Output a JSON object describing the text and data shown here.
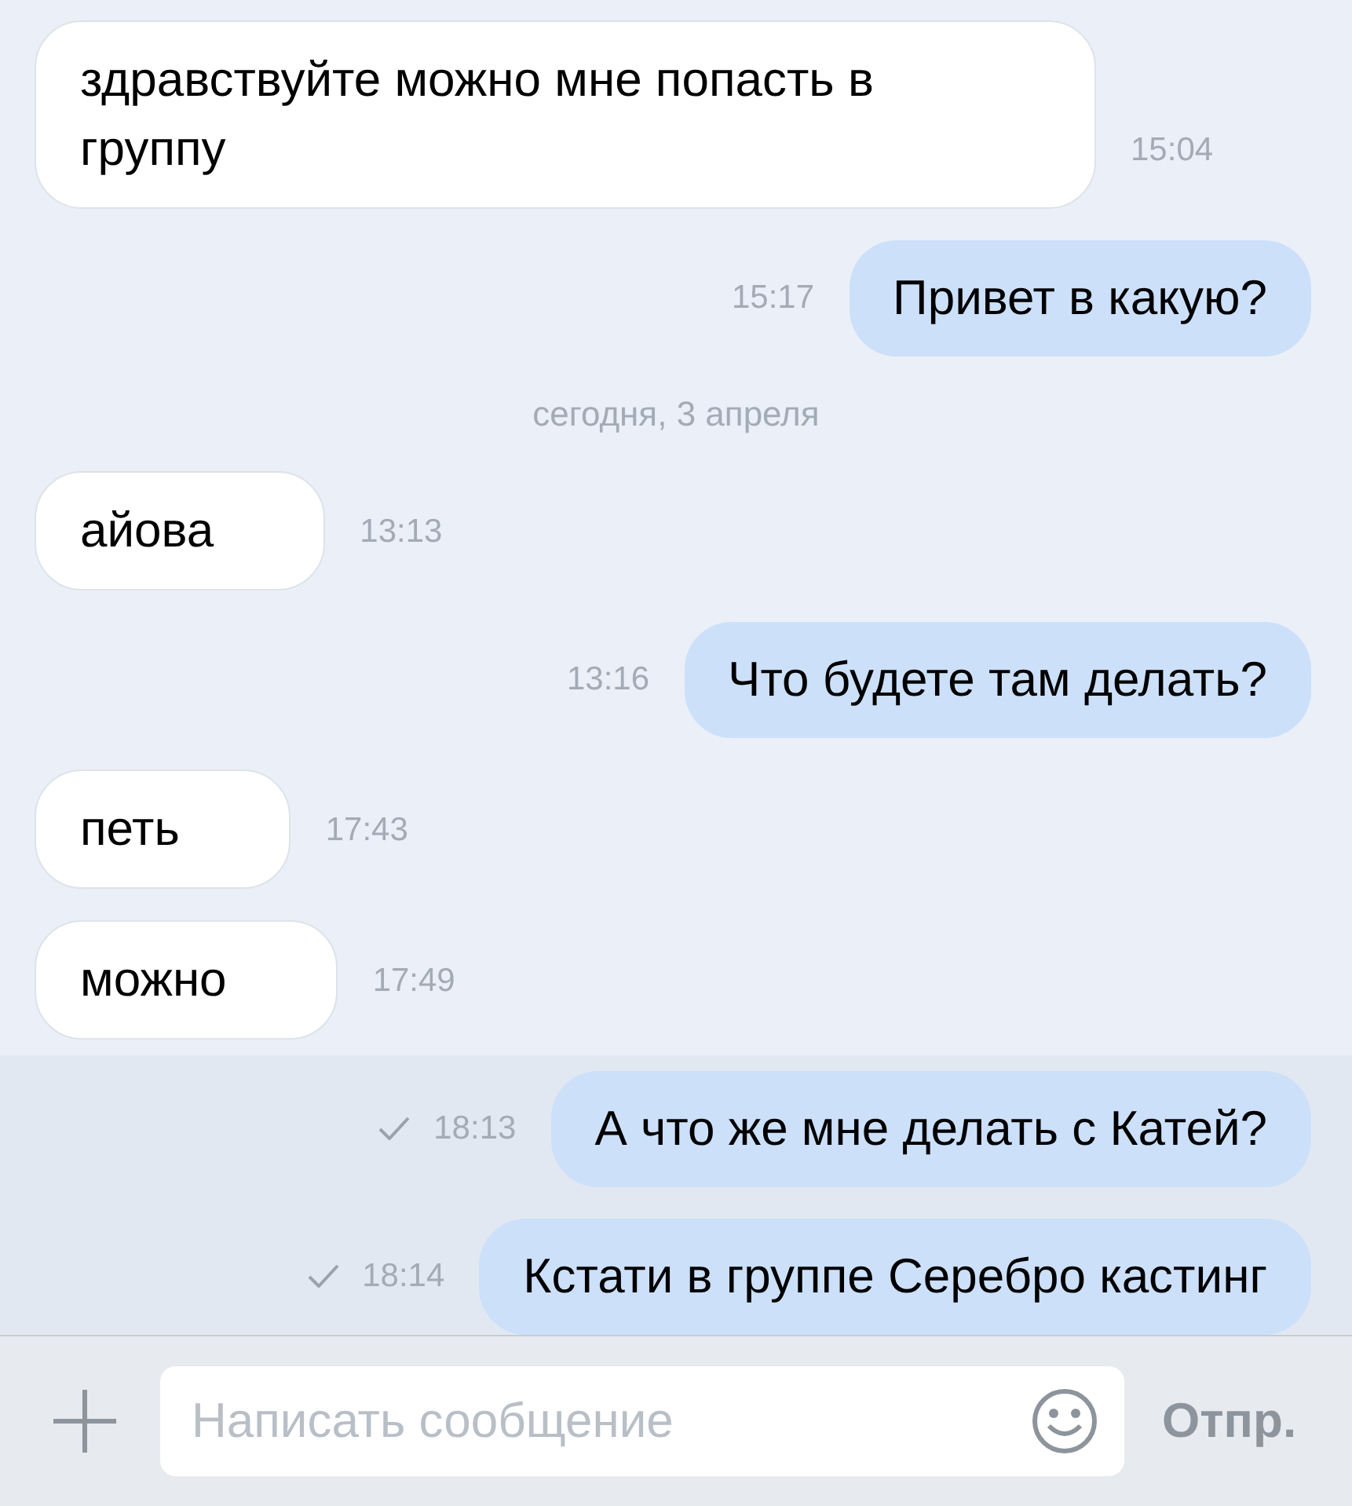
{
  "messages": [
    {
      "kind": "message",
      "outgoing": false,
      "text": "здравствуйте можно мне попасть в группу",
      "time": "15:04"
    },
    {
      "kind": "message",
      "outgoing": true,
      "text": "Привет в какую?",
      "time": "15:17",
      "read": true
    },
    {
      "kind": "date",
      "text": "сегодня, 3 апреля"
    },
    {
      "kind": "message",
      "outgoing": false,
      "text": "айова",
      "time": "13:13"
    },
    {
      "kind": "message",
      "outgoing": true,
      "text": "Что будете там делать?",
      "time": "13:16",
      "read": true
    },
    {
      "kind": "message",
      "outgoing": false,
      "text": "петь",
      "time": "17:43"
    },
    {
      "kind": "message",
      "outgoing": false,
      "text": "можно",
      "time": "17:49"
    },
    {
      "kind": "message",
      "outgoing": true,
      "text": "А что же мне делать с Катей?",
      "time": "18:13",
      "read": false
    },
    {
      "kind": "message",
      "outgoing": true,
      "text": "Кстати в группе Серебро кастинг",
      "time": "18:14",
      "read": false
    }
  ],
  "composer": {
    "placeholder": "Написать сообщение",
    "send_label": "Отпр."
  }
}
